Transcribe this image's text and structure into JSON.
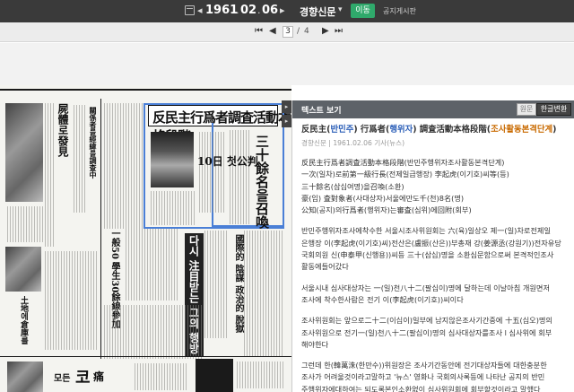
{
  "toolbar": {
    "year": "1961",
    "month": "02",
    "day": "06",
    "unit_month": "",
    "unit_day": "",
    "newspaper": "경향신문",
    "go_label": "이동",
    "notice_label": "공지게시판"
  },
  "page_nav": {
    "current": "3",
    "sep": "/",
    "total": "4"
  },
  "text_view": {
    "panel_title": "텍스트 보기",
    "original_label": "원문",
    "hangul_label": "한글변환",
    "article_title": "反民主(반민주) 行爲者(행위자) 調査活動本格段階(조사활동본격단계)",
    "meta": "경향신문 | 1961.02.06 기사(뉴스)",
    "lead_lines": [
      "反民主行爲者調査活動本格段階(반민주행위자조사활동본격단계)",
      "一次(일차)로前第一級行長(전제일급행장) 李起虎(이기호)씨等(등)",
      "三十餘名(삼십여명)을召喚(소환)",
      "豪(임) 査對象者(사대상자)서울에만도千(천)8名(명)",
      "公知(공지)의行爲者(행위자)는審査(심위)에回附(회부)"
    ],
    "paragraph1": [
      "반민주행위자조사에착수한 서울시조사위원회는 六(육)일상오 제一(일)차로전제일",
      "은행장 이(李起虎(이기호)씨)전산은(盧振(산은))부총재 강(姜源丞(강원기))전자유당",
      "국회의원 신(申泰甲(신행용))씨등 三十(삼십)명을 소환심문함으로써 본격적인조사",
      "활동에들어갔다"
    ],
    "paragraph2": [
      "서울시내 심사대상자는 一(일)천八十二(팔십이)명에 달하는데 이날아침 개원면저",
      "조사에 착수한사람은 전기 이(李起虎(이기호))씨이다"
    ],
    "paragraph3": [
      "조사위원회는 앞으로二十二(이십이)일부에 남지않은조사기간중에 十五(십오)명의",
      "조사위원으로 전기一(일)천八十二(팔십이)명의 심사대상자를조사 l 심사위에 회부",
      "해야한다"
    ],
    "paragraph4": [
      "그런데 한(韓萬洙(한만수))위원장은 조사기간동안에 전기대상자들에 대한충분한",
      "조사가 어려울것이라고말하고 '뉴스' 영화나 국회의사록등에 나타난 공지의 반민",
      "주행위자에대하여는 되도록본인소환없이 심사위원회에 회부할것이라고 말했다"
    ]
  },
  "scan": {
    "headline_right": "反民主行爲者調査活動本格段階",
    "headline_vertical": "三十餘名을召喚",
    "subhead": "10日 첫公判",
    "colors": {
      "selection": "#4a7fd6",
      "link_blue": "#2c5fb8",
      "link_orange": "#c96a00",
      "go_green": "#2fa96b"
    }
  }
}
